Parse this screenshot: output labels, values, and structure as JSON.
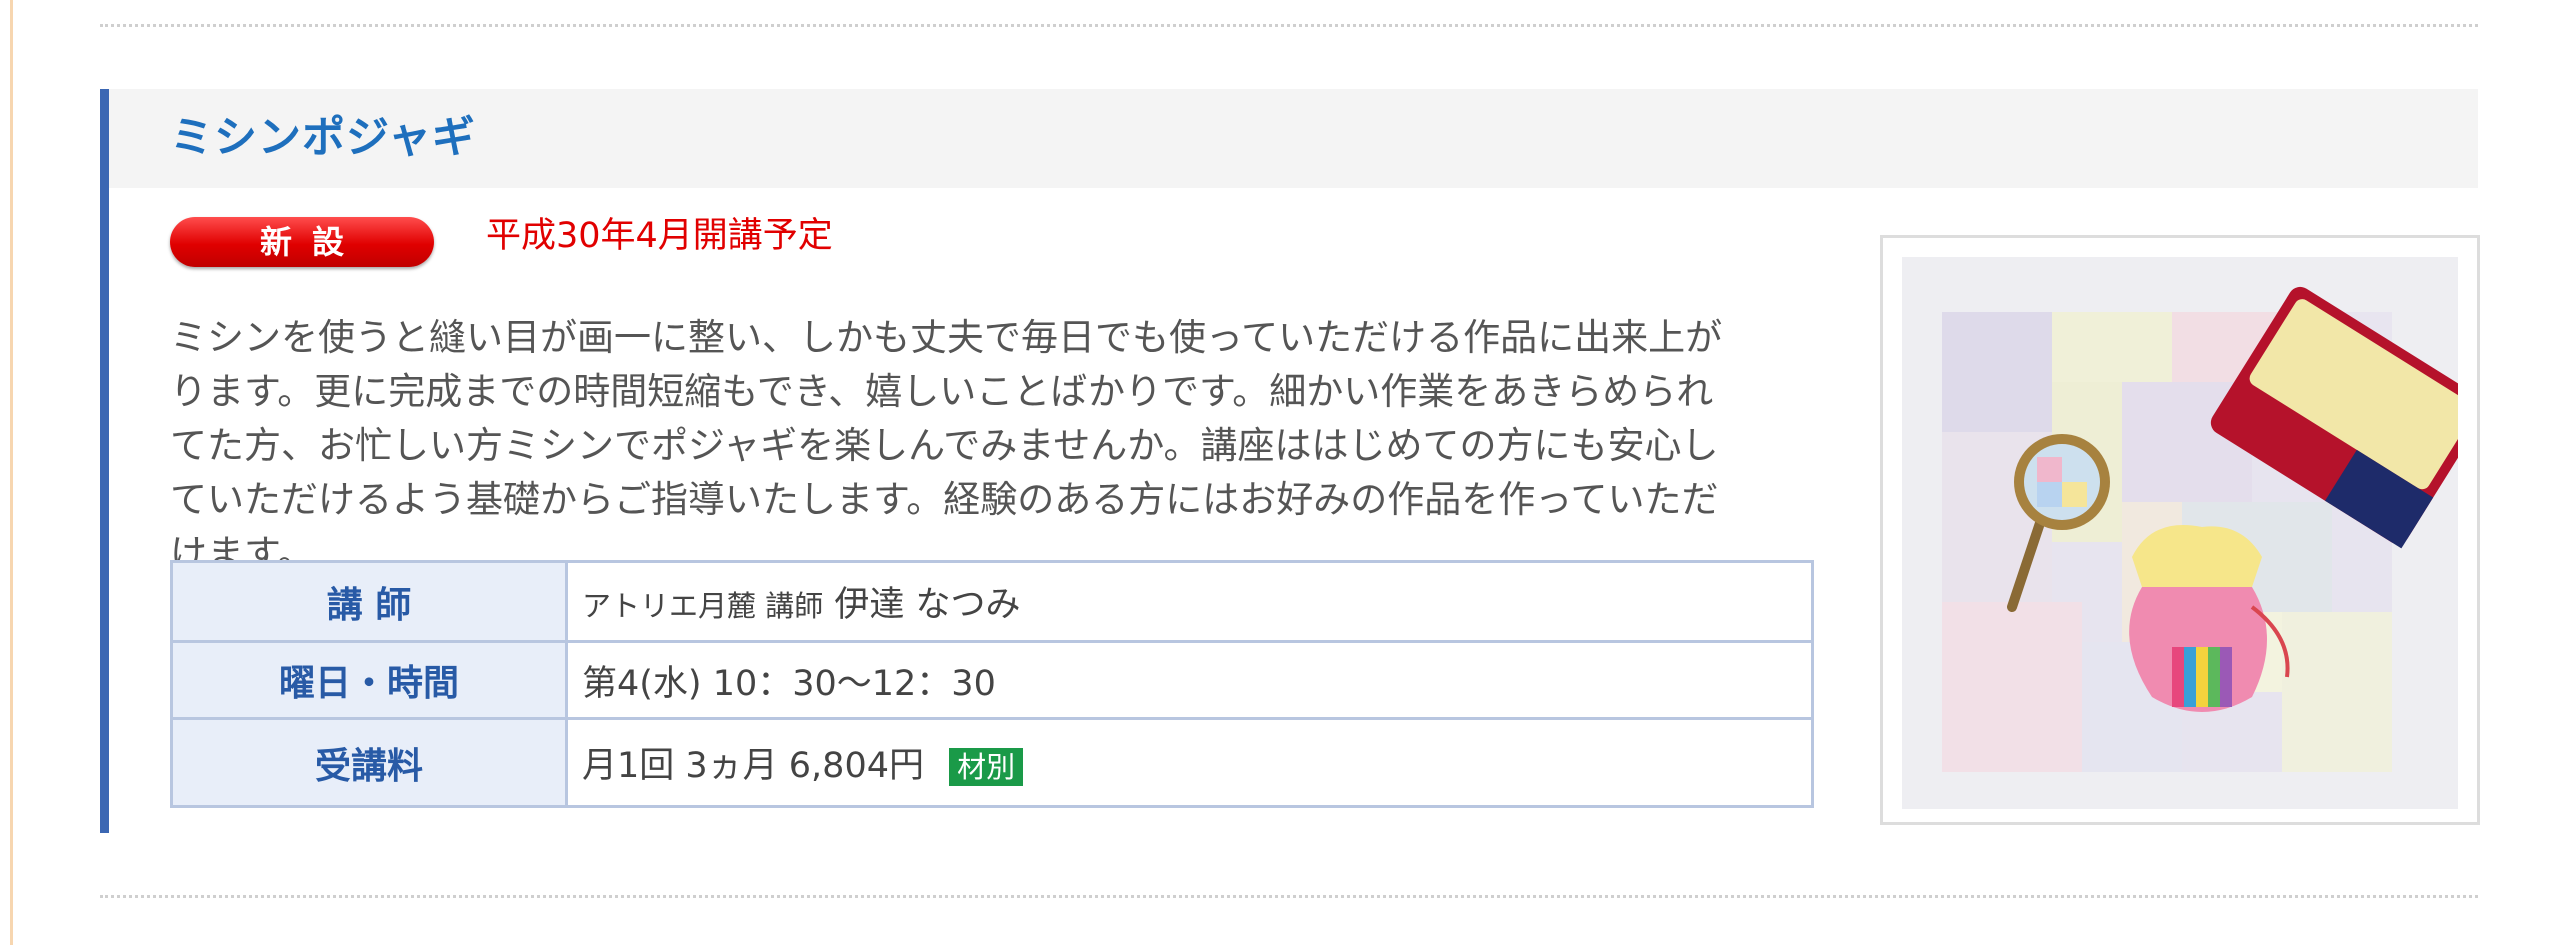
{
  "course": {
    "title": "ミシンポジャギ",
    "badge": "新設",
    "schedule_note": "平成30年4月開講予定",
    "description": "ミシンを使うと縫い目が画一に整い、しかも丈夫で毎日でも使っていただける作品に出来上がります。更に完成までの時間短縮もでき、嬉しいことばかりです。細かい作業をあきらめられてた方、お忙しい方ミシンでポジャギを楽しんでみませんか。講座ははじめての方にも安心していただけるよう基礎からご指導いたします。経験のある方にはお好みの作品を作っていただけます。",
    "table": {
      "instructor_label": "講 師",
      "instructor_prefix": "アトリエ月麓 講師",
      "instructor_name": "伊達 なつみ",
      "schedule_label": "曜日・時間",
      "schedule_value": "第4(水) 10：30〜12：30",
      "fee_label": "受講料",
      "fee_value": "月1回 3ヵ月 6,804円",
      "fee_tag": "材別"
    }
  },
  "colors": {
    "title": "#1e6fbd",
    "accent_bar": "#3b67b3",
    "badge": "#e00000",
    "note": "#e10000",
    "table_header_bg": "#e8eef9",
    "tag": "#1a9a48"
  }
}
